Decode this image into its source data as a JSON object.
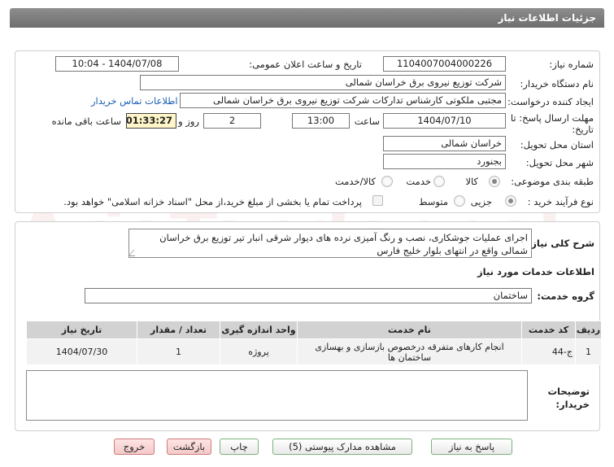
{
  "header": {
    "title": "جزئیات اطلاعات نیاز"
  },
  "form": {
    "need_number_label": "شماره نیاز:",
    "need_number": "1104007004000226",
    "announce_label": "تاریخ و ساعت اعلان عمومی:",
    "announce_value": "1404/07/08 - 10:04",
    "buyer_org_label": "نام دستگاه خریدار:",
    "buyer_org": "شرکت توزیع نیروی برق خراسان شمالی",
    "creator_label": "ایجاد کننده درخواست:",
    "creator": "مجتبی ملکوتی کارشناس تدارکات شرکت توزیع نیروی برق خراسان شمالی",
    "contact_link": "اطلاعات تماس خریدار",
    "deadline_label_1": "مهلت ارسال پاسخ: تا",
    "deadline_label_2": "تاریخ:",
    "deadline_date": "1404/07/10",
    "time_label": "ساعت",
    "deadline_time": "13:00",
    "days_value": "2",
    "days_and_label": "روز و",
    "remaining_time": "01:33:27",
    "remaining_label": "ساعت باقی مانده",
    "province_label": "استان محل تحویل:",
    "province": "خراسان شمالی",
    "city_label": "شهر محل تحویل:",
    "city": "بجنورد",
    "category_label": "طبقه بندی موضوعی:",
    "category_options": [
      "کالا",
      "خدمت",
      "کالا/خدمت"
    ],
    "process_label": "نوع فرآیند خرید :",
    "process_options": [
      "جزیی",
      "متوسط"
    ],
    "payment_note": "پرداخت تمام یا بخشی از مبلغ خرید،از محل \"اسناد خزانه اسلامی\" خواهد بود."
  },
  "summary": {
    "label": "شرح کلی نیاز:",
    "text": "اجرای عملیات جوشکاری، نصب و رنگ آمیزی نرده های دیوار شرقی انبار تیر توزیع برق خراسان شمالی واقع در انتهای بلوار خلیج فارس"
  },
  "services": {
    "section_title": "اطلاعات خدمات مورد نیاز",
    "group_label": "گروه خدمت:",
    "group_value": "ساختمان",
    "columns": [
      "ردیف",
      "کد خدمت",
      "نام خدمت",
      "واحد اندازه گیری",
      "تعداد / مقدار",
      "تاریخ نیاز"
    ],
    "rows": [
      [
        "1",
        "ج-44",
        "انجام کارهای متفرقه درخصوص بازسازی و بهسازی ساختمان ها",
        "پروژه",
        "1",
        "1404/07/30"
      ]
    ]
  },
  "notes": {
    "label_1": "توضیحات",
    "label_2": "خریدار:"
  },
  "buttons": {
    "reply": "پاسخ به نیاز",
    "attachments": "مشاهده مدارک پیوستی (5)",
    "print": "چاپ",
    "back": "بازگشت",
    "exit": "خروج"
  },
  "watermark": "AriaTender.net"
}
